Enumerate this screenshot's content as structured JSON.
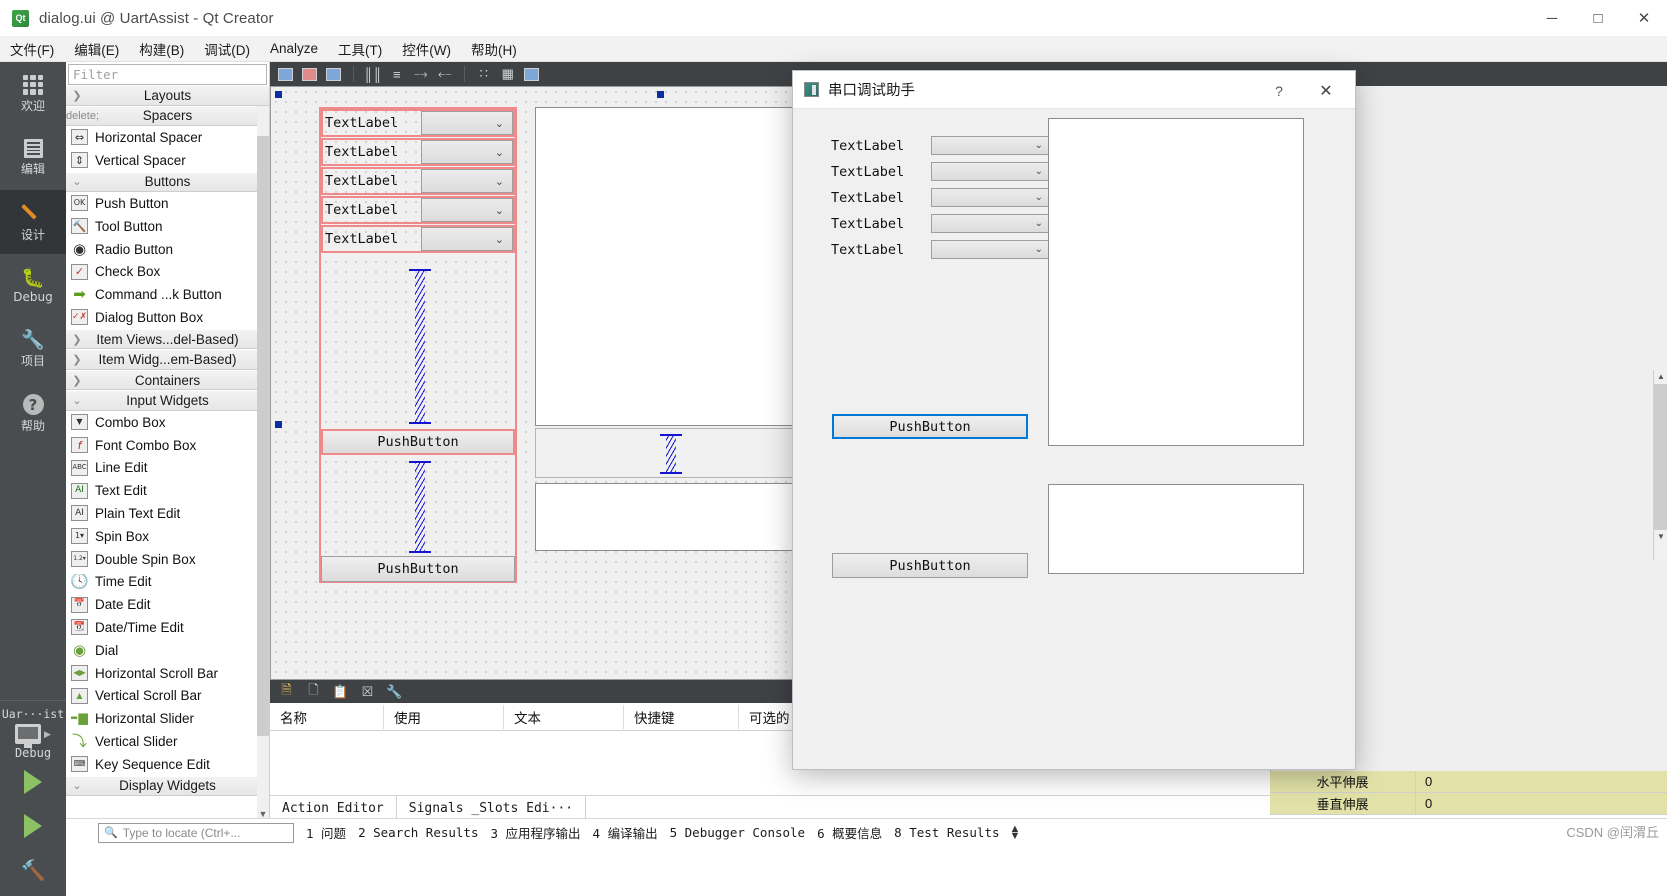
{
  "window": {
    "title": "dialog.ui @ UartAssist - Qt Creator",
    "icon": "qt-creator-icon",
    "minimize": "─",
    "maximize": "□",
    "close": "✕"
  },
  "menubar": [
    {
      "label": "文件(F)",
      "name": "menu-file"
    },
    {
      "label": "编辑(E)",
      "name": "menu-edit"
    },
    {
      "label": "构建(B)",
      "name": "menu-build"
    },
    {
      "label": "调试(D)",
      "name": "menu-debug"
    },
    {
      "label": "Analyze",
      "name": "menu-analyze"
    },
    {
      "label": "工具(T)",
      "name": "menu-tools"
    },
    {
      "label": "控件(W)",
      "name": "menu-window"
    },
    {
      "label": "帮助(H)",
      "name": "menu-help"
    }
  ],
  "modebar": {
    "items": [
      {
        "label": "欢迎",
        "icon": "grid-dots-icon",
        "active": false
      },
      {
        "label": "编辑",
        "icon": "document-lines-icon",
        "active": false
      },
      {
        "label": "设计",
        "icon": "pencil-icon",
        "active": true
      },
      {
        "label": "Debug",
        "icon": "bug-icon",
        "active": false
      },
      {
        "label": "项目",
        "icon": "wrench-icon",
        "active": false
      },
      {
        "label": "帮助",
        "icon": "question-circle-icon",
        "active": false
      }
    ],
    "kit": {
      "project": "Uar···ist",
      "config": "Debug",
      "monitor_icon": "monitor-icon",
      "run_icon": "run-triangle-icon",
      "debug_icon": "run-debug-icon",
      "build_icon": "hammer-icon"
    }
  },
  "editor_toolbar": {
    "lock_icon": "lock-icon",
    "filename": "dialog.ui",
    "dropdown_icon": "chevron-down-icon",
    "close_icon": "close-icon",
    "buttons": [
      {
        "name": "edit-widgets-button",
        "glyph": "▤"
      },
      {
        "name": "edit-signals-slots-button",
        "glyph": "▥"
      },
      {
        "name": "edit-buddies-button",
        "glyph": "▧"
      },
      {
        "name": "edit-tab-order-button",
        "glyph": "⒇"
      },
      {
        "name": "layout-horizontally-button",
        "glyph": "‖‖"
      },
      {
        "name": "layout-vertically-button",
        "glyph": "≡"
      },
      {
        "name": "layout-horizontally-splitter-button",
        "glyph": "⧉"
      },
      {
        "name": "layout-vertically-splitter-button",
        "glyph": "⧈"
      },
      {
        "name": "layout-form-button",
        "glyph": "∷"
      },
      {
        "name": "layout-grid-button",
        "glyph": "∷∷"
      },
      {
        "name": "break-layout-button",
        "glyph": "⬚"
      }
    ]
  },
  "widgetbox": {
    "filter_placeholder": "Filter",
    "groups": [
      {
        "name": "Layouts",
        "expanded": false,
        "items": []
      },
      {
        "name": "Spacers",
        "expanded": true,
        "items": [
          {
            "label": "Horizontal Spacer",
            "icon": "horizontal-spacer-icon"
          },
          {
            "label": "Vertical Spacer",
            "icon": "vertical-spacer-icon"
          }
        ]
      },
      {
        "name": "Buttons",
        "expanded": true,
        "items": [
          {
            "label": "Push Button",
            "icon": "push-button-icon"
          },
          {
            "label": "Tool Button",
            "icon": "tool-button-icon"
          },
          {
            "label": "Radio Button",
            "icon": "radio-button-icon"
          },
          {
            "label": "Check Box",
            "icon": "check-box-icon"
          },
          {
            "label": "Command ...k Button",
            "icon": "command-link-button-icon"
          },
          {
            "label": "Dialog Button Box",
            "icon": "dialog-button-box-icon"
          }
        ]
      },
      {
        "name": "Item Views...del-Based)",
        "expanded": false,
        "items": []
      },
      {
        "name": "Item Widg...em-Based)",
        "expanded": false,
        "items": []
      },
      {
        "name": "Containers",
        "expanded": false,
        "items": []
      },
      {
        "name": "Input Widgets",
        "expanded": true,
        "items": [
          {
            "label": "Combo Box",
            "icon": "combo-box-icon"
          },
          {
            "label": "Font Combo Box",
            "icon": "font-combo-box-icon"
          },
          {
            "label": "Line Edit",
            "icon": "line-edit-icon"
          },
          {
            "label": "Text Edit",
            "icon": "text-edit-icon"
          },
          {
            "label": "Plain Text Edit",
            "icon": "plain-text-edit-icon"
          },
          {
            "label": "Spin Box",
            "icon": "spin-box-icon"
          },
          {
            "label": "Double Spin Box",
            "icon": "double-spin-box-icon"
          },
          {
            "label": "Time Edit",
            "icon": "time-edit-icon"
          },
          {
            "label": "Date Edit",
            "icon": "date-edit-icon"
          },
          {
            "label": "Date/Time Edit",
            "icon": "date-time-edit-icon"
          },
          {
            "label": "Dial",
            "icon": "dial-icon"
          },
          {
            "label": "Horizontal Scroll Bar",
            "icon": "horizontal-scroll-bar-icon"
          },
          {
            "label": "Vertical Scroll Bar",
            "icon": "vertical-scroll-bar-icon"
          },
          {
            "label": "Horizontal Slider",
            "icon": "horizontal-slider-icon"
          },
          {
            "label": "Vertical Slider",
            "icon": "vertical-slider-icon"
          },
          {
            "label": "Key Sequence Edit",
            "icon": "key-sequence-edit-icon"
          }
        ]
      },
      {
        "name": "Display Widgets",
        "expanded": false,
        "items": []
      }
    ]
  },
  "canvas": {
    "form_rows": [
      {
        "label": "TextLabel",
        "combo_value": ""
      },
      {
        "label": "TextLabel",
        "combo_value": ""
      },
      {
        "label": "TextLabel",
        "combo_value": ""
      },
      {
        "label": "TextLabel",
        "combo_value": ""
      },
      {
        "label": "TextLabel",
        "combo_value": ""
      }
    ],
    "buttons": [
      {
        "label": "PushButton",
        "name": "canvas-pushbutton-1"
      },
      {
        "label": "PushButton",
        "name": "canvas-pushbutton-2"
      }
    ],
    "spacers": [
      "vertical-spacer-1",
      "vertical-spacer-2",
      "vertical-spacer-3"
    ]
  },
  "action_editor": {
    "toolbar_icons": [
      {
        "name": "new-action-icon",
        "glyph": "🗋"
      },
      {
        "name": "copy-action-icon",
        "glyph": "🗐"
      },
      {
        "name": "paste-action-icon",
        "glyph": "📋"
      },
      {
        "name": "delete-action-icon",
        "glyph": "☒"
      },
      {
        "name": "configure-action-icon",
        "glyph": "🔧"
      }
    ],
    "columns": [
      "名称",
      "使用",
      "文本",
      "快捷键",
      "可选的"
    ],
    "rows": [],
    "tabs": [
      {
        "label": "Action Editor",
        "active": true
      },
      {
        "label": "Signals _Slots Edi···",
        "active": false
      }
    ]
  },
  "property_editor": {
    "rows": [
      {
        "name": "水平伸展",
        "value": "0",
        "highlighted": true
      },
      {
        "name": "垂直伸展",
        "value": "0",
        "highlighted": true
      }
    ]
  },
  "statusbar": {
    "locate_icon": "search-icon",
    "locate_placeholder": "Type to locate (Ctrl+...",
    "panes": [
      "1 问题",
      "2 Search Results",
      "3 应用程序输出",
      "4 编译输出",
      "5 Debugger Console",
      "6 概要信息",
      "8 Test Results"
    ],
    "watermark": "CSDN @闰渭丘"
  },
  "dialog": {
    "title": "串口调试助手",
    "icon": "app-icon",
    "help_button": "?",
    "close_button": "✕",
    "form_rows": [
      {
        "label": "TextLabel",
        "combo_value": ""
      },
      {
        "label": "TextLabel",
        "combo_value": ""
      },
      {
        "label": "TextLabel",
        "combo_value": ""
      },
      {
        "label": "TextLabel",
        "combo_value": ""
      },
      {
        "label": "TextLabel",
        "combo_value": ""
      }
    ],
    "primary_button": "PushButton",
    "secondary_button": "PushButton",
    "output_top": "",
    "output_bottom": ""
  },
  "colors": {
    "accent_blue": "#0078d7",
    "selection_red": "#f08a8a",
    "spacer_blue": "#1414d0",
    "highlight_yellow": "#e2e2a8",
    "dark_chrome": "#3f4245",
    "mode_bar": "#4a4d4f"
  }
}
